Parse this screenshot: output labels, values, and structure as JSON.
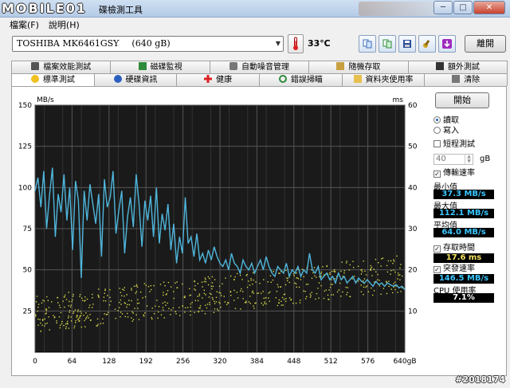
{
  "window": {
    "logo": "MOBILE01",
    "title": "碟檢測工具",
    "minimize": "─",
    "maximize": "□",
    "close": "✕"
  },
  "menu": [
    "檔案(F)",
    "說明(H)"
  ],
  "toolbar": {
    "drive": "TOSHIBA MK6461GSY",
    "capacity": "(640 gB)",
    "temperature": "33℃",
    "exit_label": "離開"
  },
  "tabs_top": [
    {
      "label": "檔案效能測試",
      "icon": "doc-icon"
    },
    {
      "label": "磁碟監視",
      "icon": "monitor-icon"
    },
    {
      "label": "自動噪音管理",
      "icon": "speaker-icon"
    },
    {
      "label": "隨機存取",
      "icon": "random-icon"
    },
    {
      "label": "額外測試",
      "icon": "extra-icon"
    }
  ],
  "tabs_bottom": [
    {
      "label": "標準測試",
      "icon": "bulb-icon",
      "active": true
    },
    {
      "label": "硬碟資訊",
      "icon": "info-icon"
    },
    {
      "label": "健康",
      "icon": "cross-icon"
    },
    {
      "label": "錯誤掃瞄",
      "icon": "magnifier-icon"
    },
    {
      "label": "資料夾使用率",
      "icon": "folder-icon"
    },
    {
      "label": "清除",
      "icon": "trash-icon"
    }
  ],
  "controls": {
    "start_label": "開始",
    "read_label": "讀取",
    "write_label": "寫入",
    "mode": "read",
    "short_test_label": "短程測試",
    "short_test_checked": false,
    "short_test_value": "40",
    "short_test_unit": "gB",
    "transfer_rate_label": "傳輸速率",
    "transfer_rate_checked": true,
    "min_label": "最小值",
    "min_value": "37.3 MB/s",
    "max_label": "最大值",
    "max_value": "112.1 MB/s",
    "avg_label": "平均值",
    "avg_value": "64.0 MB/s",
    "access_time_label": "存取時間",
    "access_time_checked": true,
    "access_time_value": "17.6 ms",
    "burst_rate_label": "突發速率",
    "burst_rate_checked": true,
    "burst_rate_value": "146.5 MB/s",
    "cpu_label": "CPU 使用率",
    "cpu_value": "7.1%"
  },
  "watermark": "#2018174",
  "colors": {
    "transfer_line": "#4fb6dc",
    "access_dots": "#d6d64a",
    "plot_bg": "#1a1a1a",
    "grid": "#555555",
    "value_text": "#39c6ff"
  },
  "chart_data": {
    "type": "line",
    "ylabel_left": "MB/s",
    "ylabel_right": "ms",
    "x_ticks": [
      "0",
      "64",
      "128",
      "192",
      "256",
      "320",
      "384",
      "448",
      "512",
      "576",
      "640gB"
    ],
    "y_left_ticks": [
      "150",
      "125",
      "100",
      "75",
      "50",
      "25"
    ],
    "y_right_ticks": [
      "60",
      "50",
      "40",
      "30",
      "20",
      "10"
    ],
    "xlim": [
      0,
      640
    ],
    "ylim_left": [
      0,
      150
    ],
    "ylim_right": [
      0,
      60
    ],
    "grid": true,
    "series": [
      {
        "unit": "MB/s",
        "axis": "left",
        "x": [
          0,
          5,
          10,
          15,
          20,
          25,
          30,
          35,
          40,
          45,
          50,
          55,
          60,
          65,
          70,
          75,
          80,
          85,
          90,
          95,
          100,
          105,
          110,
          115,
          120,
          125,
          130,
          135,
          140,
          145,
          150,
          155,
          160,
          165,
          170,
          175,
          180,
          185,
          190,
          195,
          200,
          205,
          210,
          215,
          220,
          225,
          230,
          235,
          240,
          245,
          250,
          255,
          260,
          265,
          270,
          275,
          280,
          285,
          290,
          295,
          300,
          305,
          310,
          315,
          320,
          325,
          330,
          335,
          340,
          345,
          350,
          355,
          360,
          365,
          370,
          375,
          380,
          385,
          390,
          395,
          400,
          405,
          410,
          415,
          420,
          425,
          430,
          435,
          440,
          445,
          450,
          455,
          460,
          465,
          470,
          475,
          480,
          485,
          490,
          495,
          500,
          505,
          510,
          515,
          520,
          525,
          530,
          535,
          540,
          545,
          550,
          555,
          560,
          565,
          570,
          575,
          580,
          585,
          590,
          595,
          600,
          605,
          610,
          615,
          620,
          625,
          630,
          635,
          640
        ],
        "y": [
          98,
          106,
          88,
          110,
          75,
          95,
          112,
          70,
          96,
          85,
          108,
          80,
          100,
          62,
          104,
          92,
          45,
          98,
          80,
          102,
          90,
          78,
          96,
          58,
          105,
          88,
          94,
          110,
          72,
          86,
          98,
          60,
          82,
          94,
          76,
          108,
          90,
          64,
          92,
          80,
          95,
          70,
          100,
          66,
          84,
          74,
          90,
          62,
          78,
          54,
          70,
          60,
          94,
          66,
          70,
          58,
          72,
          56,
          60,
          54,
          62,
          56,
          64,
          58,
          54,
          52,
          56,
          50,
          60,
          54,
          52,
          48,
          56,
          52,
          50,
          54,
          48,
          52,
          56,
          50,
          58,
          52,
          48,
          46,
          52,
          50,
          48,
          54,
          46,
          50,
          48,
          52,
          46,
          50,
          48,
          60,
          50,
          48,
          52,
          44,
          46,
          48,
          44,
          46,
          42,
          48,
          44,
          46,
          42,
          44,
          46,
          42,
          45,
          43,
          42,
          44,
          42,
          40,
          43,
          41,
          42,
          40,
          42,
          41,
          40,
          41,
          39,
          40,
          38
        ]
      },
      {
        "unit": "ms",
        "axis": "right",
        "x_range": [
          0,
          640
        ],
        "y_range": [
          8,
          28
        ],
        "style": "scatter"
      }
    ]
  }
}
